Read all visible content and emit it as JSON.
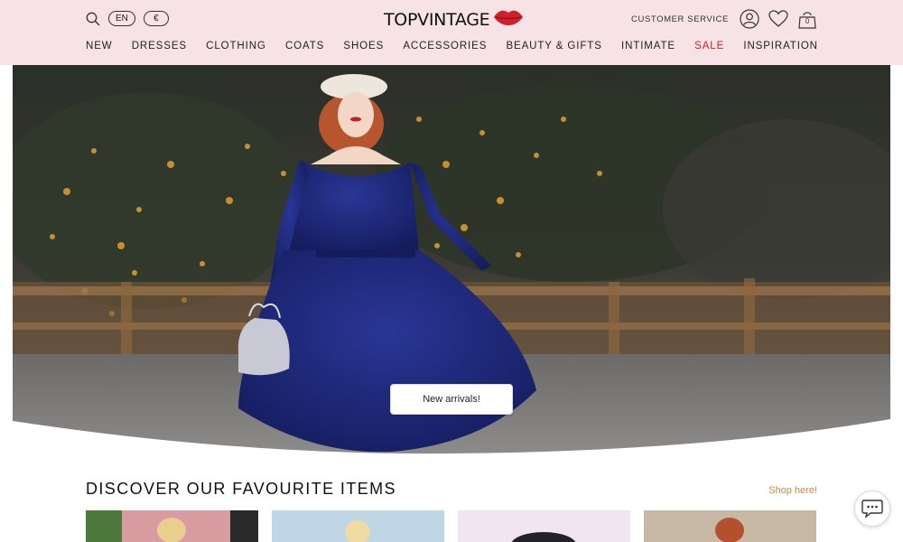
{
  "header": {
    "language": "EN",
    "currency": "€",
    "logo_text": "TOPVINTAGE",
    "customer_service": "CUSTOMER SERVICE",
    "icons": [
      "search-icon",
      "account-icon",
      "heart-icon",
      "shopping-bag-icon",
      "lips-logo-icon"
    ],
    "bag_count": "0"
  },
  "nav": {
    "items": [
      {
        "label": "NEW"
      },
      {
        "label": "DRESSES"
      },
      {
        "label": "CLOTHING"
      },
      {
        "label": "COATS"
      },
      {
        "label": "SHOES"
      },
      {
        "label": "ACCESSORIES"
      },
      {
        "label": "BEAUTY & GIFTS"
      },
      {
        "label": "INTIMATE"
      },
      {
        "label": "SALE"
      },
      {
        "label": "INSPIRATION"
      }
    ]
  },
  "hero": {
    "cta_label": "New arrivals!"
  },
  "section": {
    "title": "DISCOVER OUR FAVOURITE ITEMS",
    "shop_link": "Shop here!"
  },
  "colors": {
    "header_bg": "#f7e3e6",
    "sale": "#c0262d",
    "shop_link": "#c8894a",
    "logo_lips": "#d0202b",
    "dress": "#1f2a7a"
  },
  "chat": {
    "icon": "chat-bubble-icon"
  }
}
